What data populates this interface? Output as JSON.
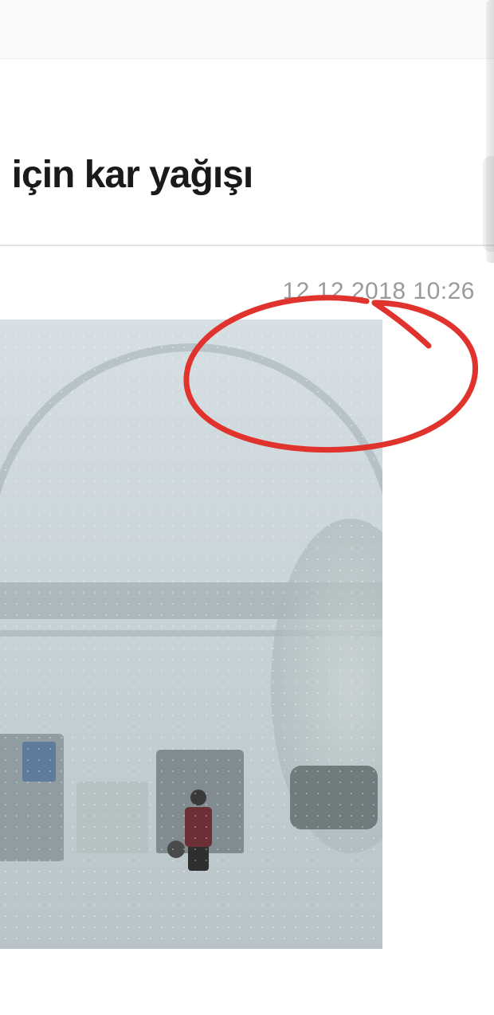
{
  "header": {
    "headline_fragment": "l için kar yağışı"
  },
  "article": {
    "timestamp": "12.12.2018 10:26"
  },
  "annotation": {
    "stroke": "#e1332d"
  }
}
